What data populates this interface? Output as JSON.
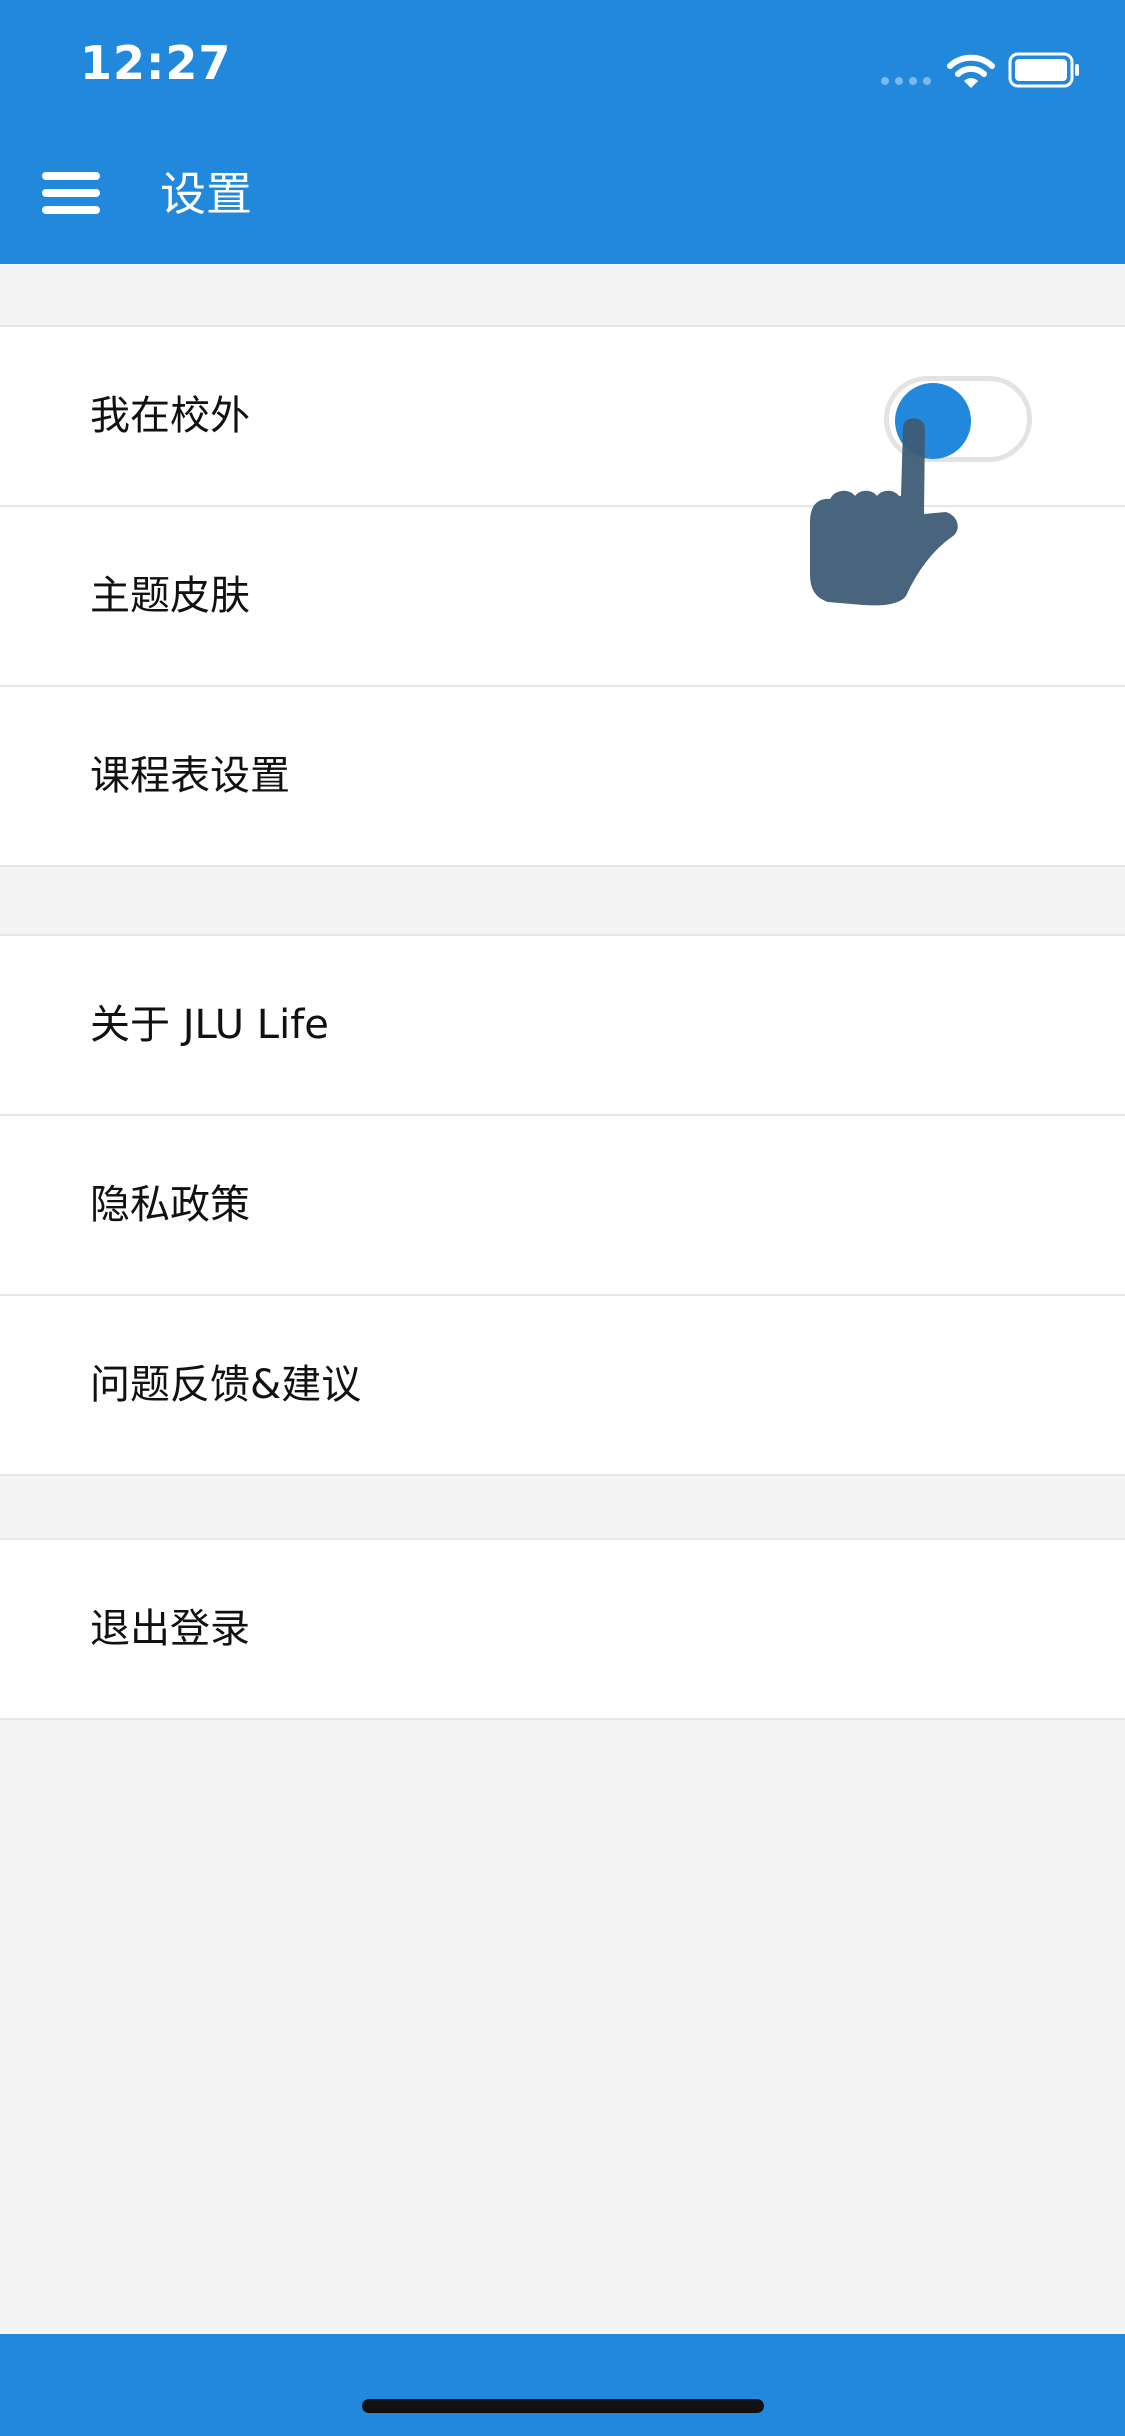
{
  "status_bar": {
    "time": "12:27",
    "signal_icon": "cellular-signal-icon",
    "wifi_icon": "wifi-icon",
    "battery_icon": "battery-icon"
  },
  "header": {
    "menu_icon": "hamburger-menu-icon",
    "title": "设置"
  },
  "groups": [
    {
      "items": [
        {
          "label": "我在校外",
          "toggle": {
            "on": true
          }
        },
        {
          "label": "主题皮肤"
        },
        {
          "label": "课程表设置"
        }
      ]
    },
    {
      "items": [
        {
          "label": "关于 JLU Life"
        },
        {
          "label": "隐私政策"
        },
        {
          "label": "问题反馈&建议"
        }
      ]
    },
    {
      "items": [
        {
          "label": "退出登录"
        }
      ]
    }
  ],
  "overlay": {
    "icon": "tap-hand-pointer-icon"
  },
  "colors": {
    "primary": "#2288db",
    "background": "#f4f4f4",
    "cell": "#ffffff",
    "divider": "#e6e6e6",
    "text": "#111111",
    "hand": "#3f5c76"
  }
}
